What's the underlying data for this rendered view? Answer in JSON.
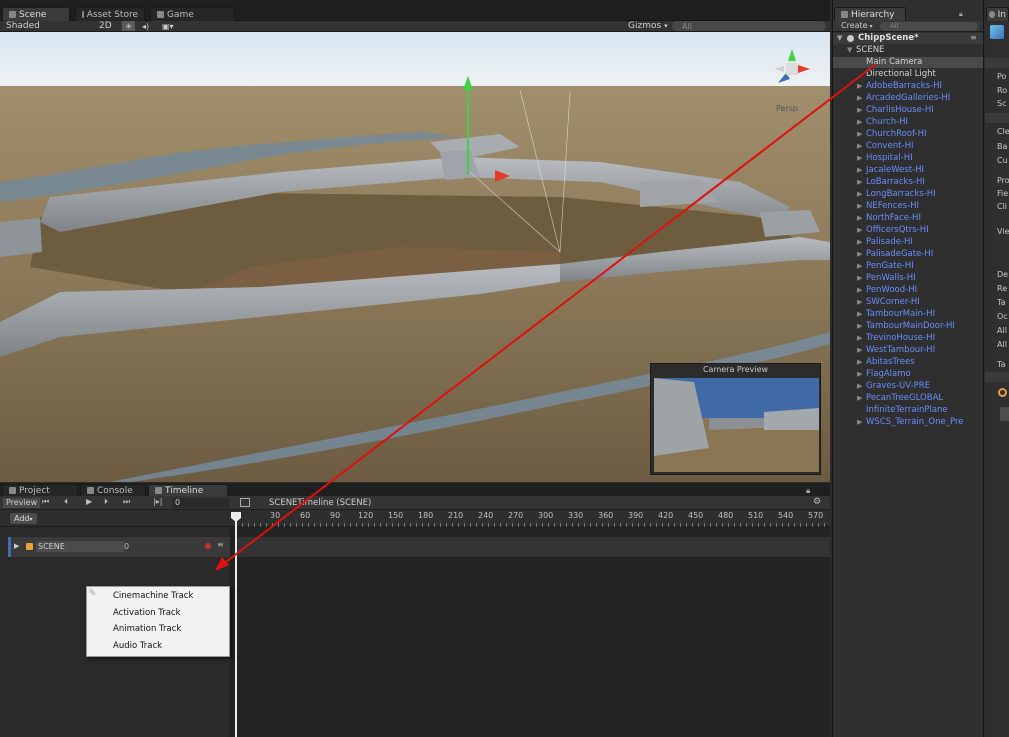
{
  "scene_tabs": {
    "scene": "Scene",
    "asset_store": "Asset Store",
    "game": "Game"
  },
  "scene_toolbar": {
    "shading": "Shaded",
    "mode2d": "2D",
    "gizmos": "Gizmos",
    "search_placeholder": "All"
  },
  "scene_view": {
    "persp_label": "Persp",
    "camera_preview_title": "Camera Preview"
  },
  "hierarchy": {
    "title": "Hierarchy",
    "create_label": "Create",
    "search_placeholder": "All",
    "scene_name": "ChippScene*",
    "root_item": "SCENE",
    "items": [
      {
        "label": "Main Camera",
        "color": "white",
        "expandable": false,
        "selected": true
      },
      {
        "label": "Directional Light",
        "color": "white",
        "expandable": false
      },
      {
        "label": "AdobeBarracks-HI",
        "expandable": true
      },
      {
        "label": "ArcadedGalleries-HI",
        "expandable": true
      },
      {
        "label": "CharlisHouse-HI",
        "expandable": true
      },
      {
        "label": "Church-HI",
        "expandable": true
      },
      {
        "label": "ChurchRoof-HI",
        "expandable": true
      },
      {
        "label": "Convent-HI",
        "expandable": true
      },
      {
        "label": "Hospital-HI",
        "expandable": true
      },
      {
        "label": "JacaleWest-HI",
        "expandable": true
      },
      {
        "label": "LoBarracks-HI",
        "expandable": true
      },
      {
        "label": "LongBarracks-HI",
        "expandable": true
      },
      {
        "label": "NEFences-HI",
        "expandable": true
      },
      {
        "label": "NorthFace-HI",
        "expandable": true
      },
      {
        "label": "OfficersQtrs-HI",
        "expandable": true
      },
      {
        "label": "Palisade-HI",
        "expandable": true
      },
      {
        "label": "PalisadeGate-HI",
        "expandable": true
      },
      {
        "label": "PenGate-HI",
        "expandable": true
      },
      {
        "label": "PenWalls-HI",
        "expandable": true
      },
      {
        "label": "PenWood-HI",
        "expandable": true
      },
      {
        "label": "SWCorner-HI",
        "expandable": true
      },
      {
        "label": "TambourMain-HI",
        "expandable": true
      },
      {
        "label": "TambourMainDoor-HI",
        "expandable": true
      },
      {
        "label": "TrevinoHouse-HI",
        "expandable": true
      },
      {
        "label": "WestTambour-HI",
        "expandable": true
      },
      {
        "label": "AbitasTrees",
        "expandable": true
      },
      {
        "label": "FlagAlamo",
        "expandable": true
      },
      {
        "label": "Graves-UV-PRE",
        "expandable": true
      },
      {
        "label": "PecanTreeGLOBAL",
        "expandable": true
      },
      {
        "label": "InfiniteTerrainPlane",
        "expandable": false
      },
      {
        "label": "WSCS_Terrain_One_Pre",
        "expandable": true
      }
    ]
  },
  "inspector": {
    "title": "In",
    "labels": [
      "Po",
      "Ro",
      "Sc",
      "Cle",
      "Ba",
      "Cu",
      "Pro",
      "Fie",
      "Cli",
      "Vie",
      "De",
      "Re",
      "Ta",
      "Oc",
      "All",
      "All",
      "Ta"
    ]
  },
  "bottom_tabs": {
    "project": "Project",
    "console": "Console",
    "timeline": "Timeline"
  },
  "timeline": {
    "preview_label": "Preview",
    "frame_value": "0",
    "title": "SCENETimeline (SCENE)",
    "add_label": "Add",
    "track_name": "SCENE",
    "track_value": "0",
    "ticks": [
      "30",
      "60",
      "90",
      "120",
      "150",
      "180",
      "210",
      "240",
      "270",
      "300",
      "330",
      "360",
      "390",
      "420",
      "450",
      "480",
      "510",
      "540",
      "570"
    ]
  },
  "context_menu": {
    "items": [
      "Cinemachine Track",
      "Activation Track",
      "Animation Track",
      "Audio Track"
    ]
  },
  "colors": {
    "accent_blue": "#3d6fb6",
    "prefab_text": "#6a8dff",
    "arrow_red": "#e01010",
    "panel_bg": "#2b2b2b"
  }
}
